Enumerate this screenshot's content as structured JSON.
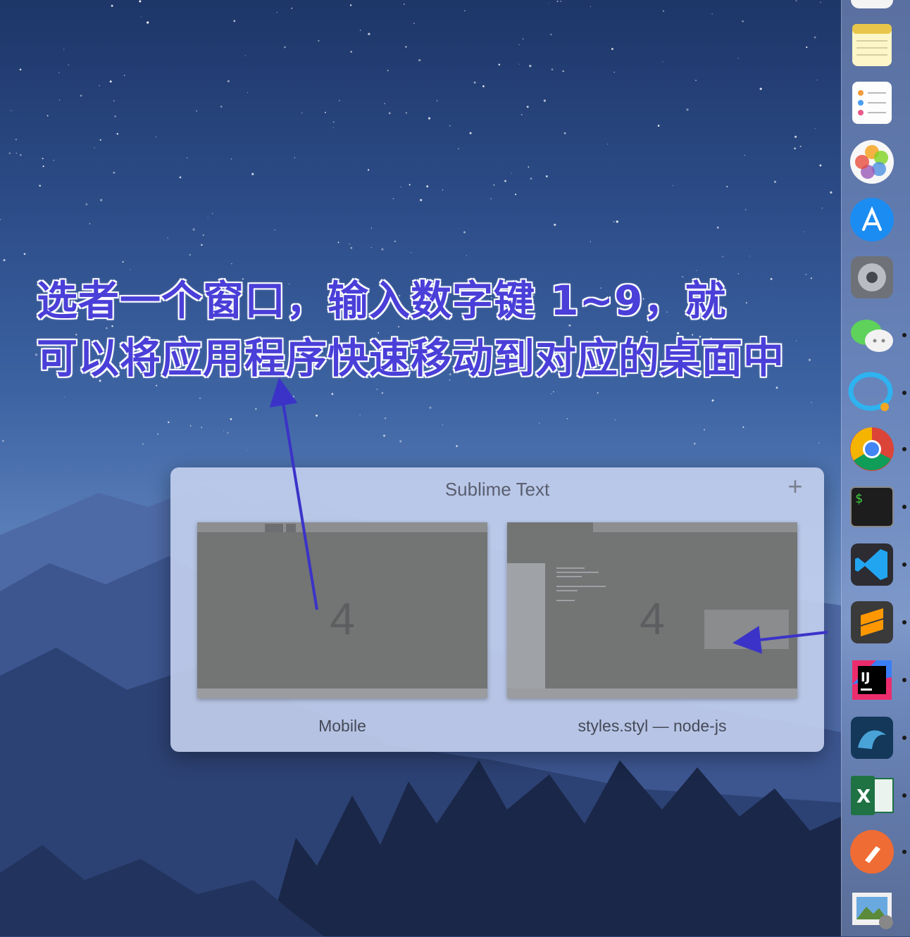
{
  "annotation": {
    "line1": "选者一个窗口，输入数字键 1~9，就",
    "line2": "可以将应用程序快速移动到对应的桌面中"
  },
  "switcher": {
    "title": "Sublime Text",
    "add_label": "+",
    "windows": [
      {
        "name": "Mobile",
        "desktop_number": "4"
      },
      {
        "name": "styles.styl — node-js",
        "desktop_number": "4"
      }
    ]
  },
  "dock": {
    "items": [
      {
        "name": "Calendar",
        "icon": "calendar-icon",
        "running": false
      },
      {
        "name": "Notes",
        "icon": "notes-icon",
        "running": false
      },
      {
        "name": "Reminders",
        "icon": "reminders-icon",
        "running": false
      },
      {
        "name": "Photos",
        "icon": "photos-icon",
        "running": false
      },
      {
        "name": "App Store",
        "icon": "app-store-icon",
        "running": false
      },
      {
        "name": "System Preferences",
        "icon": "system-preferences-icon",
        "running": false
      },
      {
        "name": "WeChat",
        "icon": "wechat-icon",
        "running": true
      },
      {
        "name": "QQ Chat",
        "icon": "chat-bubble-icon",
        "running": true
      },
      {
        "name": "Google Chrome",
        "icon": "chrome-icon",
        "running": true
      },
      {
        "name": "Terminal",
        "icon": "terminal-icon",
        "running": true
      },
      {
        "name": "Visual Studio Code",
        "icon": "vscode-icon",
        "running": true
      },
      {
        "name": "Sublime Text",
        "icon": "sublime-text-icon",
        "running": true
      },
      {
        "name": "IntelliJ IDEA",
        "icon": "intellij-icon",
        "running": true
      },
      {
        "name": "MySQL Workbench",
        "icon": "mysql-workbench-icon",
        "running": true
      },
      {
        "name": "Microsoft Excel",
        "icon": "excel-icon",
        "running": true
      },
      {
        "name": "Postman",
        "icon": "postman-icon",
        "running": true
      },
      {
        "name": "Preview",
        "icon": "preview-icon",
        "running": false
      }
    ]
  },
  "terminal_prompt": "$",
  "intellij_glyph": "IJ",
  "excel_glyph": "X",
  "colors": {
    "annotation_fill": "#4a3fd8",
    "annotation_arrow": "#3b33c8",
    "switcher_bg": "#c4d0ee"
  }
}
